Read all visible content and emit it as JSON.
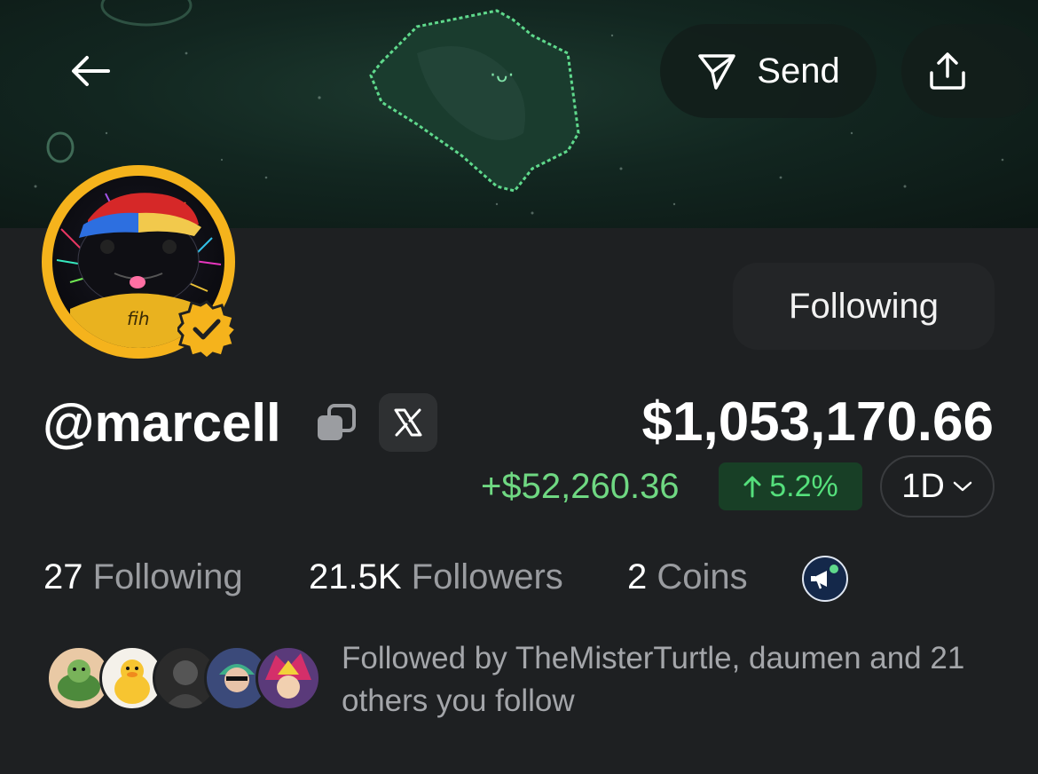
{
  "header": {
    "back_icon": "arrow-left-icon",
    "send_label": "Send",
    "send_icon": "paper-plane-icon",
    "share_icon": "share-upload-icon"
  },
  "profile": {
    "avatar_caption": "fih",
    "verified": true,
    "follow_button_label": "Following",
    "handle": "@marcell",
    "x_label": "𝕏"
  },
  "portfolio": {
    "balance": "$1,053,170.66",
    "change_amount": "+$52,260.36",
    "change_percent": "5.2%",
    "period": "1D",
    "colors": {
      "positive": "#6fd882",
      "positive_badge_bg": "#183f26",
      "verified_badge": "#f5b31c"
    }
  },
  "stats": [
    {
      "count": "27",
      "label": "Following"
    },
    {
      "count": "21.5K",
      "label": "Followers"
    },
    {
      "count": "2",
      "label": "Coins"
    }
  ],
  "followed_by": {
    "text": "Followed by TheMisterTurtle, daumen and 21 others you follow"
  }
}
